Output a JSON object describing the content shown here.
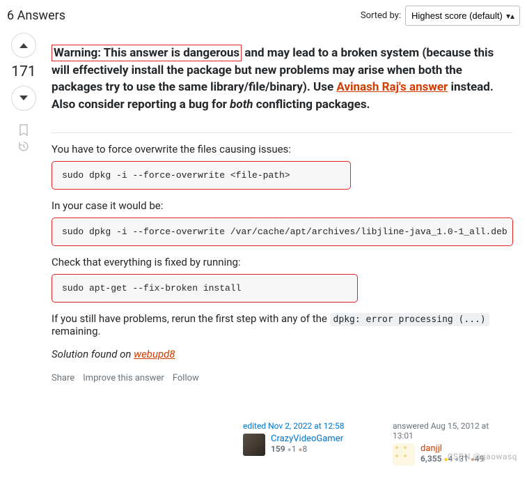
{
  "header": {
    "answers_count_label": "6 Answers",
    "sorted_by_label": "Sorted by:",
    "sort_selected": "Highest score (default)"
  },
  "vote": {
    "score": "171"
  },
  "warning": {
    "danger_prefix": "Warning: This answer is dangerous",
    "rest1": " and may lead to a broken system (because this will effectively install the package but new problems may arise when both the packages try to use the same library/file/binary). Use ",
    "avinash_link_text": "Avinash Raj's answer",
    "rest2": " instead. Also consider reporting a bug for ",
    "both_word": "both",
    "rest3": " conflicting packages."
  },
  "body": {
    "p1": "You have to force overwrite the files causing issues:",
    "code1": "sudo dpkg -i --force-overwrite <file-path>",
    "p2": "In your case it would be:",
    "code2": "sudo dpkg -i --force-overwrite /var/cache/apt/archives/libjline-java_1.0-1_all.deb",
    "p3": "Check that everything is fixed by running:",
    "code3": "sudo apt-get --fix-broken install",
    "p4_pre": "If you still have problems, rerun the first step with any of the ",
    "p4_code": "dpkg: error processing (...)",
    "p4_post": " remaining.",
    "solution_pre": "Solution found on ",
    "solution_link": "webupd8"
  },
  "actions": {
    "share": "Share",
    "improve": "Improve this answer",
    "follow": "Follow"
  },
  "editor": {
    "when": "edited Nov 2, 2022 at 12:58",
    "name": "CrazyVideoGamer",
    "rep": "159",
    "silver": "1",
    "bronze": "8"
  },
  "author": {
    "when": "answered Aug 15, 2012 at 13:01",
    "name": "danjjl",
    "rep": "6,355",
    "gold": "4",
    "silver": "31",
    "bronze": "49"
  },
  "watermark": "CSDN @gaowasq"
}
